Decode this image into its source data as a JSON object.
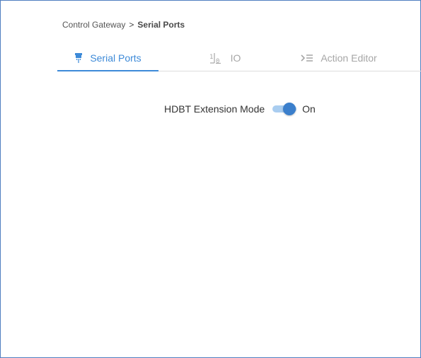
{
  "breadcrumb": {
    "parent": "Control Gateway",
    "separator": ">",
    "current": "Serial Ports"
  },
  "tabs": [
    {
      "label": "Serial Ports",
      "icon": "serial-port-icon",
      "active": true
    },
    {
      "label": "IO",
      "icon": "io-icon",
      "active": false
    },
    {
      "label": "Action Editor",
      "icon": "action-editor-icon",
      "active": false
    }
  ],
  "hdbt": {
    "label": "HDBT Extension Mode",
    "state_label": "On",
    "enabled": true
  },
  "colors": {
    "accent": "#3d8ad8",
    "inactive_tab": "#a6a6a6",
    "toggle_track": "#a9cdf0",
    "toggle_knob": "#3b7fcc",
    "frame_border": "#4f7ec0"
  }
}
